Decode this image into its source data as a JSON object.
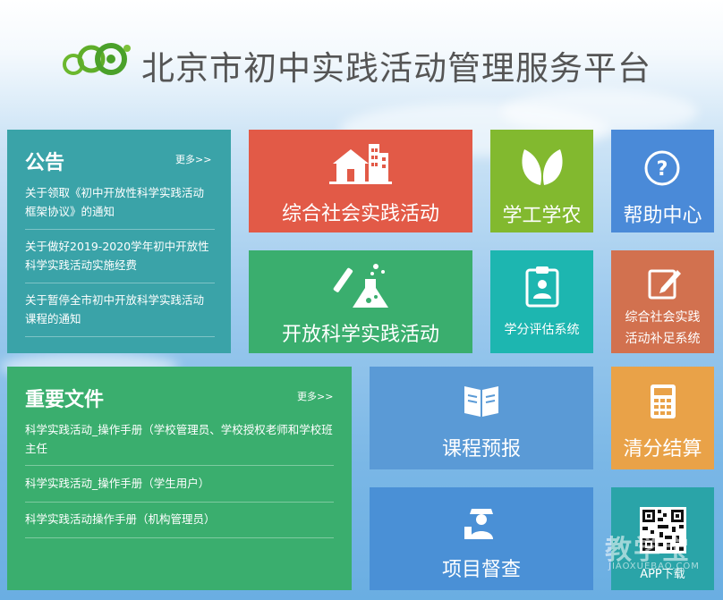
{
  "site": {
    "title": "北京市初中实践活动管理服务平台"
  },
  "notice": {
    "heading": "公告",
    "more": "更多>>",
    "items": [
      "关于领取《初中开放性科学实践活动框架协议》的通知",
      "关于做好2019-2020学年初中开放性科学实践活动实施经费",
      "关于暂停全市初中开放科学实践活动课程的通知"
    ]
  },
  "documents": {
    "heading": "重要文件",
    "more": "更多>>",
    "items": [
      "科学实践活动_操作手册（学校管理员、学校授权老师和学校班主任",
      "科学实践活动_操作手册（学生用户）",
      "科学实践活动操作手册（机构管理员）"
    ]
  },
  "tiles": {
    "social_practice": "综合社会实践活动",
    "learn_work_farm": "学工学农",
    "help_center": "帮助中心",
    "open_science": "开放科学实践活动",
    "credit_eval": "学分评估系统",
    "social_supplement_line1": "综合社会实践",
    "social_supplement_line2": "活动补足系统",
    "course_report": "课程预报",
    "score_settle": "清分结算",
    "project_supervise": "项目督查",
    "app_download": "APP下载"
  },
  "watermark": {
    "main": "教学宝",
    "sub": "JIAOXUEBAO.COM"
  },
  "colors": {
    "notice": "#3aa3a8",
    "documents": "#3aae6e",
    "social_practice": "#e25a47",
    "learn_work_farm": "#82b92f",
    "help_center": "#4a8ad8",
    "open_science": "#3aae6e",
    "credit_eval": "#1db6b0",
    "social_supplement": "#d2714f",
    "course_report": "#5a9ad6",
    "score_settle": "#e9a248",
    "project_supervise": "#4a90d6",
    "app_download": "#2aa4a8"
  }
}
